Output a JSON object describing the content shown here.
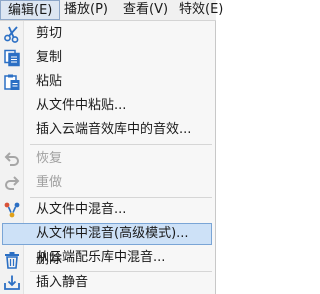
{
  "menubar": {
    "items": [
      {
        "label": "编辑(E)"
      },
      {
        "label": "播放(P)"
      },
      {
        "label": "查看(V)"
      },
      {
        "label": "特效(E)"
      }
    ]
  },
  "edit_menu": {
    "items": [
      {
        "label": "剪切",
        "icon": "scissors-icon"
      },
      {
        "label": "复制",
        "icon": "copy-icon"
      },
      {
        "label": "粘贴",
        "icon": "paste-icon"
      },
      {
        "label": "从文件中粘贴..."
      },
      {
        "label": "插入云端音效库中的音效..."
      },
      {
        "label": "恢复",
        "icon": "undo-icon",
        "disabled": true
      },
      {
        "label": "重做",
        "icon": "redo-icon",
        "disabled": true
      },
      {
        "label": "从文件中混音...",
        "icon": "mix-icon"
      },
      {
        "label": "从文件中混音(高级模式)...",
        "highlighted": true
      },
      {
        "label": "从云端配乐库中混音..."
      },
      {
        "label": "删除",
        "icon": "trash-icon"
      },
      {
        "label": "插入静音",
        "icon": "insert-silence-icon"
      }
    ]
  },
  "colors": {
    "accent_blue": "#2b6fc4",
    "highlight_bg": "#cde1f7",
    "highlight_border": "#7aa5d6",
    "disabled_text": "#a0a0a0"
  }
}
